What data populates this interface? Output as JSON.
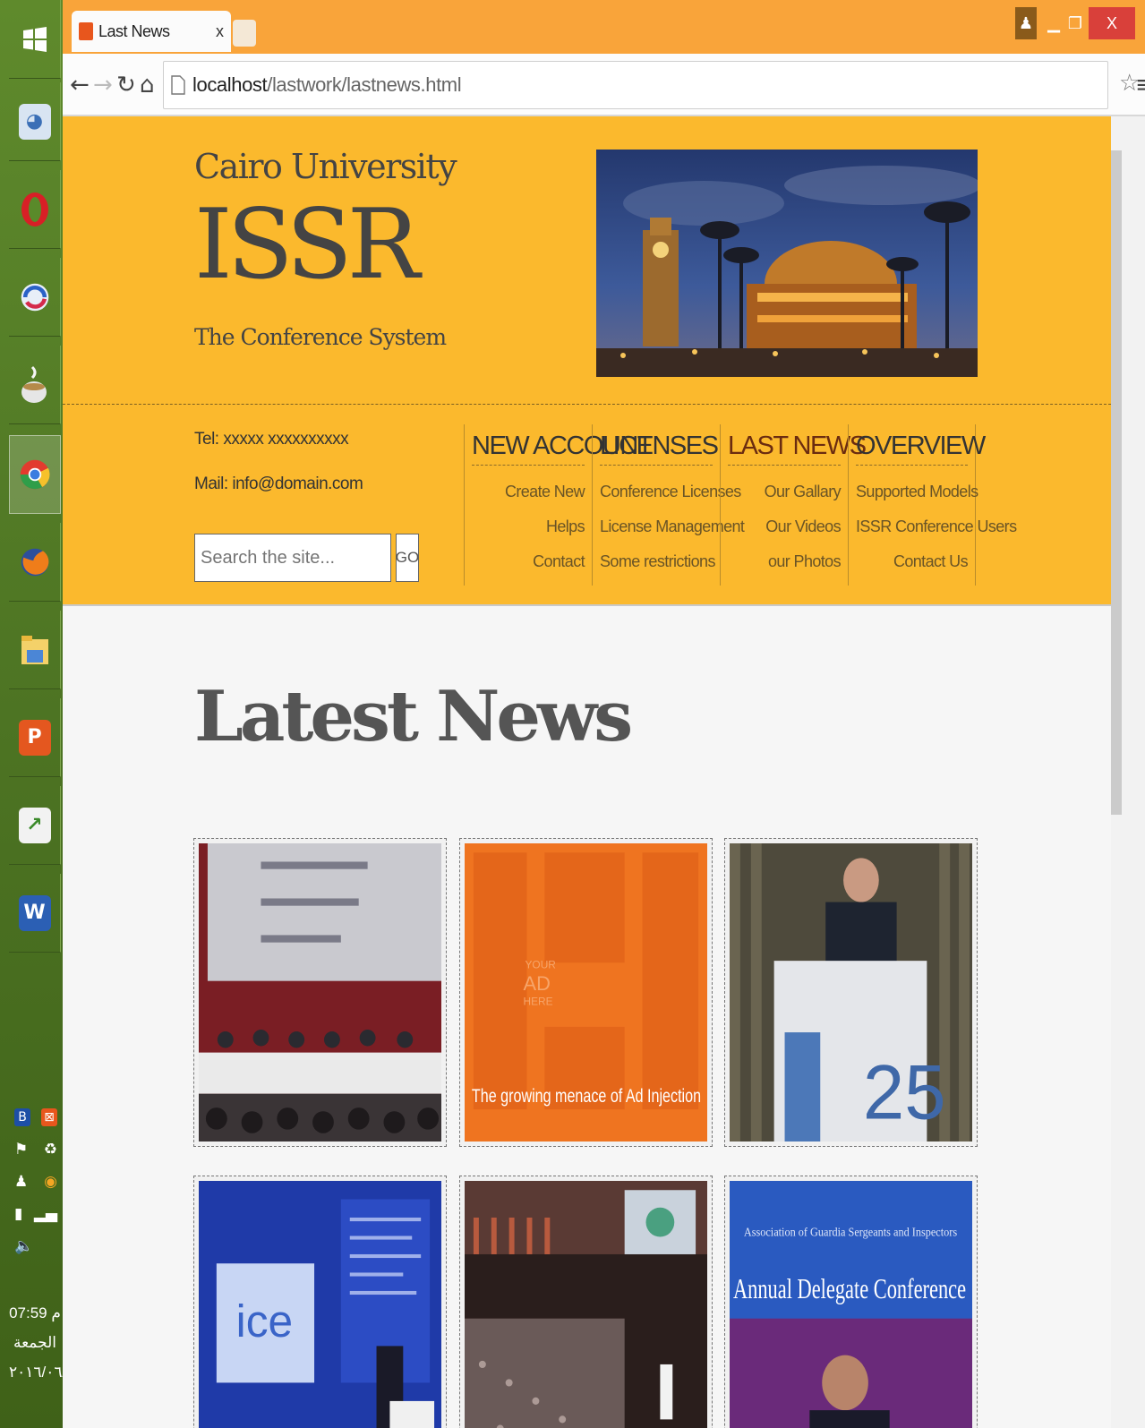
{
  "browser": {
    "tab_title": "Last News",
    "tab_close": "x",
    "url_host": "localhost",
    "url_path": "/lastwork/lastnews.html"
  },
  "site": {
    "university": "Cairo University",
    "brand": "ISSR",
    "tagline": "The Conference System",
    "tel": "Tel: xxxxx xxxxxxxxxx",
    "mail": "Mail: info@domain.com",
    "search_placeholder": "Search the site...",
    "search_button": "GO"
  },
  "menu": [
    {
      "heading": "NEW ACCOUNT",
      "items": [
        "Create New",
        "Helps",
        "Contact"
      ]
    },
    {
      "heading": "LICENSES",
      "items": [
        "Conference Licenses",
        "License Management",
        "Some restrictions"
      ]
    },
    {
      "heading": "LAST NEWS",
      "items": [
        "Our Gallary",
        "Our Videos",
        "our Photos"
      ]
    },
    {
      "heading": "OVERVIEW",
      "items": [
        "Supported Models",
        "ISSR Conference Users",
        "Contact Us"
      ]
    }
  ],
  "content": {
    "heading": "Latest News",
    "ad_caption": "The growing menace of Ad Injection",
    "ad_text": [
      "YOUR",
      "AD",
      "HERE"
    ],
    "ice_logo": "ice",
    "conference_banner": "Annual Delegate Conference",
    "banner_subtitle": "Association of Guardia Sergeants and Inspectors",
    "podium_number": "25"
  },
  "system": {
    "time": "07:59 م",
    "day": "الجمعة",
    "date": "٢٠١٦/٠٦/٠٣"
  },
  "colors": {
    "header_bg": "#fbb92d",
    "browser_frame": "#f9a43a",
    "page_bg": "#f6f6f6",
    "taskbar": "#4d7423"
  }
}
